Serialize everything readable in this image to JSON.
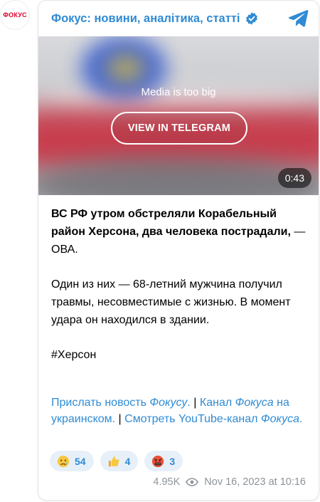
{
  "avatar": {
    "logo_text": "ФОКУС"
  },
  "header": {
    "channel_name": "Фокус: новини, аналітика, статті"
  },
  "media": {
    "message": "Media is too big",
    "button_label": "VIEW IN TELEGRAM",
    "duration": "0:43"
  },
  "post": {
    "headline": "ВС РФ утром обстреляли Корабельный район Херсона, два человека пострадали,",
    "source_suffix": " — ОВА.",
    "paragraph_2": "Один из них — 68-летний мужчина получил травмы, несовместимые с жизнью. В момент удара он находился в здании.",
    "hashtag": "#Херсон"
  },
  "footer_links": {
    "send_news_prefix": "Прислать новость ",
    "send_news_brand": "Фокусу",
    "send_news_suffix": ".",
    "sep_1": " | ",
    "channel_prefix": "Канал ",
    "channel_brand": "Фокуса",
    "channel_suffix": " на украинском.",
    "sep_2": " | ",
    "youtube_prefix": "Смотреть YouTube-канал ",
    "youtube_brand": "Фокуса",
    "youtube_suffix": "."
  },
  "reactions": [
    {
      "icon": "crying-face-icon",
      "count": "54"
    },
    {
      "icon": "thumbs-up-icon",
      "count": "4"
    },
    {
      "icon": "cursing-face-icon",
      "count": "3"
    }
  ],
  "meta": {
    "views": "4.95K",
    "timestamp": "Nov 16, 2023 at 10:16"
  },
  "colors": {
    "accent": "#2f8bd4",
    "reaction_bg": "#e7f0f9",
    "meta_text": "#8c9399",
    "logo_red": "#e0002a"
  }
}
